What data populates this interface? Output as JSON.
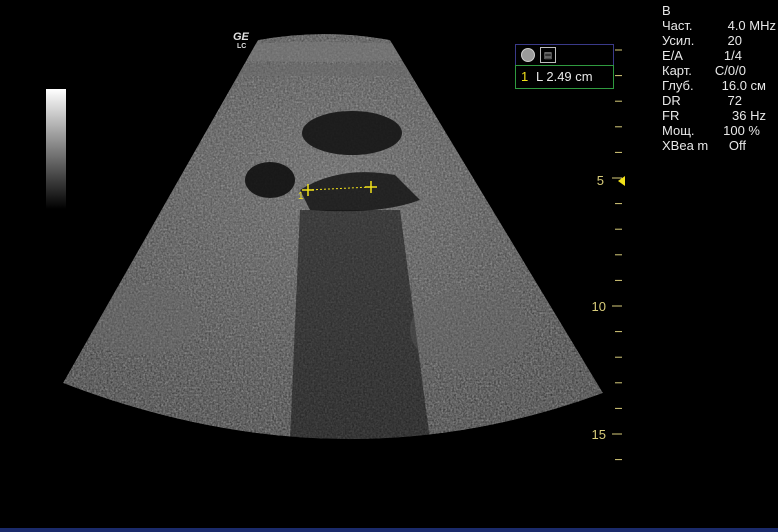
{
  "mode_label": "B",
  "params": [
    {
      "label": "Част.",
      "value": "4.0 MHz"
    },
    {
      "label": "Усил.",
      "value": "20"
    },
    {
      "label": "E/A",
      "value": "1/4"
    },
    {
      "label": "Карт.",
      "value": "C/0/0"
    },
    {
      "label": "Глуб.",
      "value": "16.0 см"
    },
    {
      "label": "DR",
      "value": "72"
    },
    {
      "label": "FR",
      "value": "36 Hz"
    },
    {
      "label": "Мощ.",
      "value": "100 %"
    },
    {
      "label": "XBea m",
      "value": "Off"
    }
  ],
  "logo": {
    "brand": "GE",
    "sub": "LC"
  },
  "measurement": {
    "index": "1",
    "text": "L  2.49 cm"
  },
  "caliper_label": "1",
  "depth_scale": [
    "5",
    "10",
    "15"
  ],
  "colors": {
    "caliper": "#f2e21a",
    "frame": "#2f9a3f",
    "depth": "#d8cc7a"
  },
  "icons": {
    "left": "circle-icon",
    "right": "probe-icon"
  }
}
